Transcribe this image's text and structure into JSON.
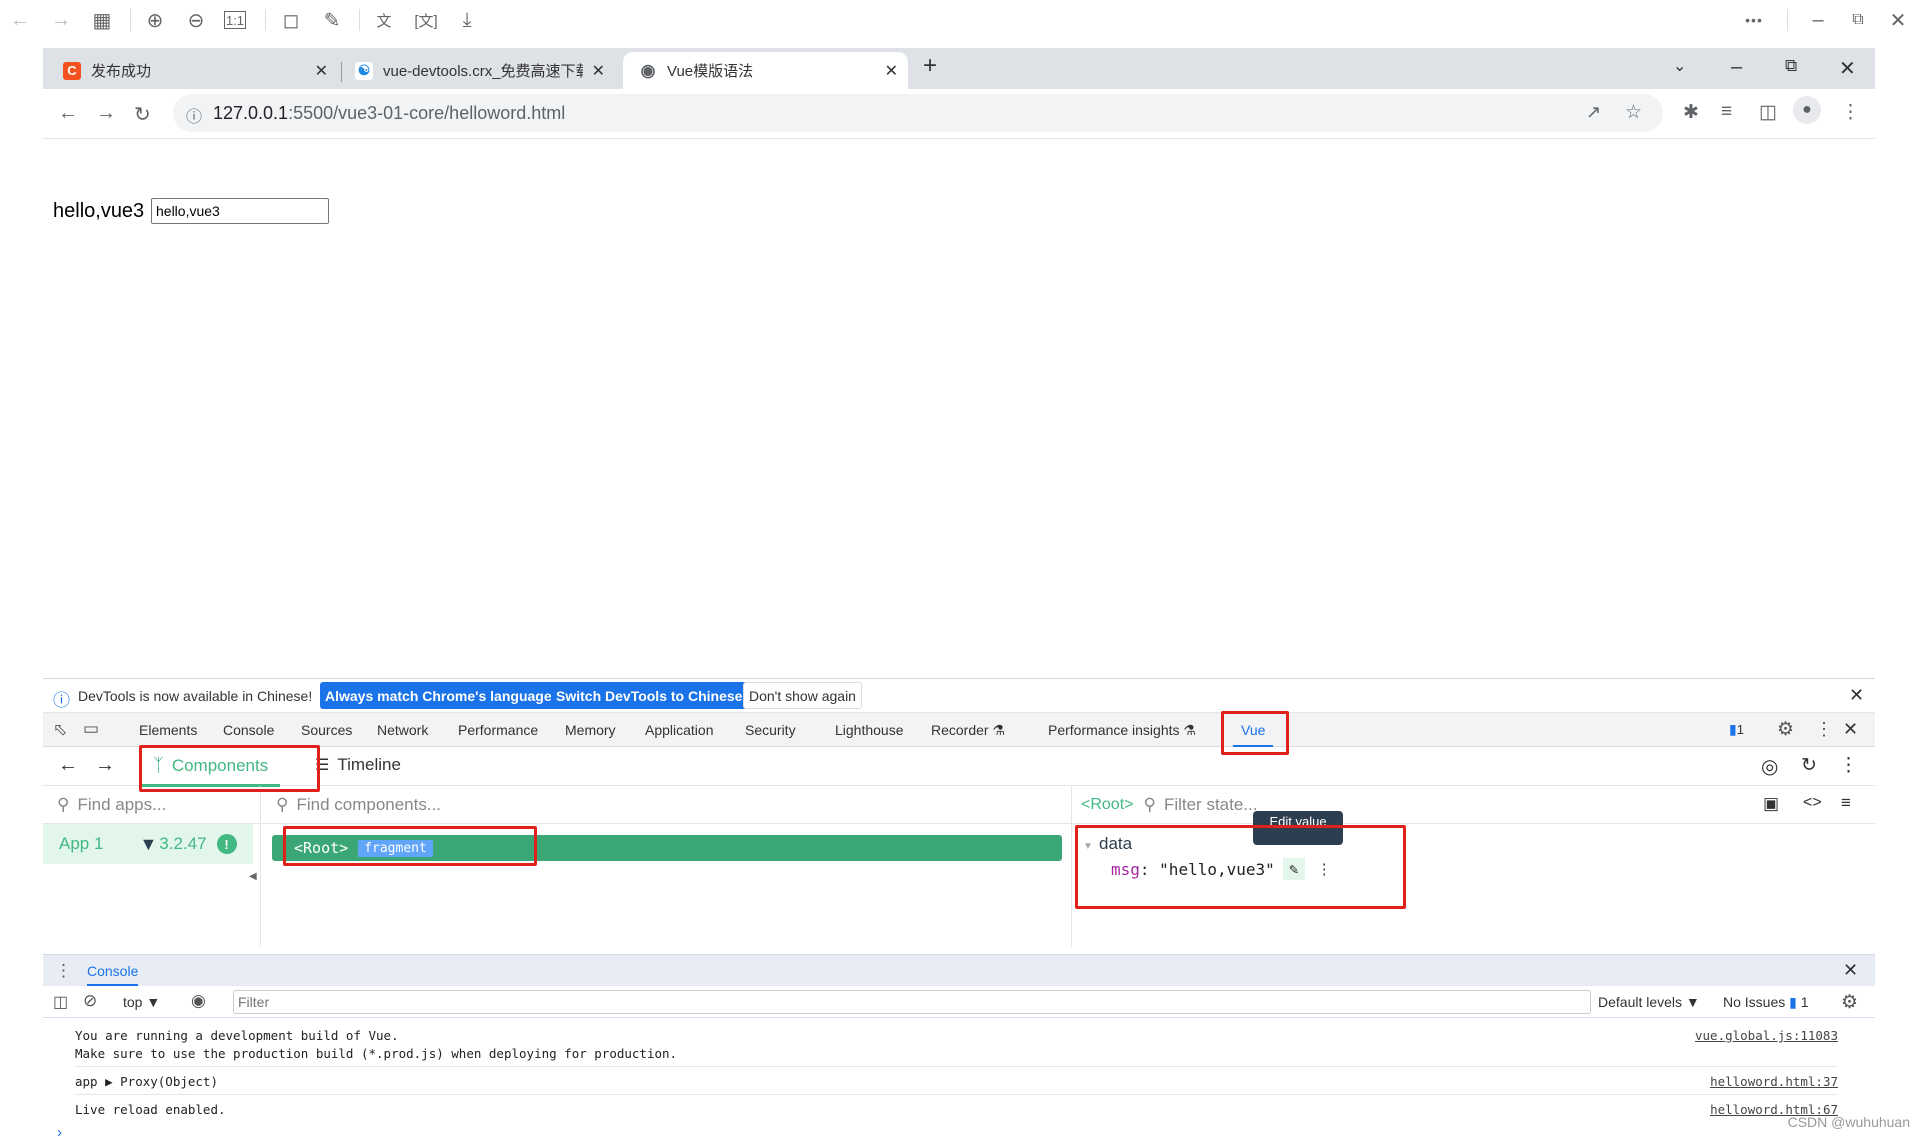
{
  "viewer_toolbar": {
    "icons": [
      "back-arrow-icon",
      "forward-arrow-icon",
      "grid-icon",
      "zoom-in-icon",
      "zoom-out-icon",
      "actual-size-icon",
      "rotate-icon",
      "edit-icon",
      "translate-icon",
      "ocr-icon",
      "download-icon"
    ],
    "more_label": "•••"
  },
  "browser": {
    "tabs": [
      {
        "title": "发布成功",
        "favicon": "C",
        "favicon_color": "#f4511e",
        "active": false
      },
      {
        "title": "vue-devtools.crx_免费高速下载",
        "favicon": "baidu-cloud-icon",
        "active": false
      },
      {
        "title": "Vue模版语法",
        "favicon": "globe-icon",
        "active": true
      }
    ],
    "new_tab_label": "+",
    "url_host": "127.0.0.1",
    "url_rest": ":5500/vue3-01-core/helloword.html"
  },
  "page": {
    "text": "hello,vue3",
    "input_value": "hello,vue3"
  },
  "devtools": {
    "infobar": {
      "message": "DevTools is now available in Chinese!",
      "btn_match": "Always match Chrome's language",
      "btn_switch": "Switch DevTools to Chinese",
      "btn_dont_show": "Don't show again"
    },
    "tabs": [
      "Elements",
      "Console",
      "Sources",
      "Network",
      "Performance",
      "Memory",
      "Application",
      "Security",
      "Lighthouse",
      "Recorder ⚗",
      "Performance insights ⚗",
      "Vue"
    ],
    "selected_tab": "Vue",
    "issues_count": "1",
    "vue": {
      "tab_components": "Components",
      "tab_timeline": "Timeline",
      "find_apps_placeholder": "Find apps...",
      "find_components_placeholder": "Find components...",
      "app_name": "App 1",
      "vue_version": "3.2.47",
      "root_tag": "<Root>",
      "fragment_label": "fragment",
      "state_root": "<Root>",
      "filter_state_placeholder": "Filter state...",
      "tooltip": "Edit value",
      "section": "data",
      "prop_key": "msg",
      "prop_value": "\"hello,vue3\""
    },
    "drawer": {
      "tab": "Console",
      "context": "top",
      "filter_placeholder": "Filter",
      "levels": "Default levels",
      "issues_label": "No Issues",
      "issues_count": "1",
      "messages": [
        {
          "lines": [
            "You are running a development build of Vue.",
            "Make sure to use the production build (*.prod.js) when deploying for production."
          ],
          "source": "vue.global.js:11083"
        },
        {
          "lines": [
            "app  ▶ Proxy(Object)"
          ],
          "source": "helloword.html:37"
        },
        {
          "lines": [
            "Live reload enabled."
          ],
          "source": "helloword.html:67"
        }
      ],
      "prompt": "›"
    }
  },
  "watermark": "CSDN @wuhuhuan"
}
